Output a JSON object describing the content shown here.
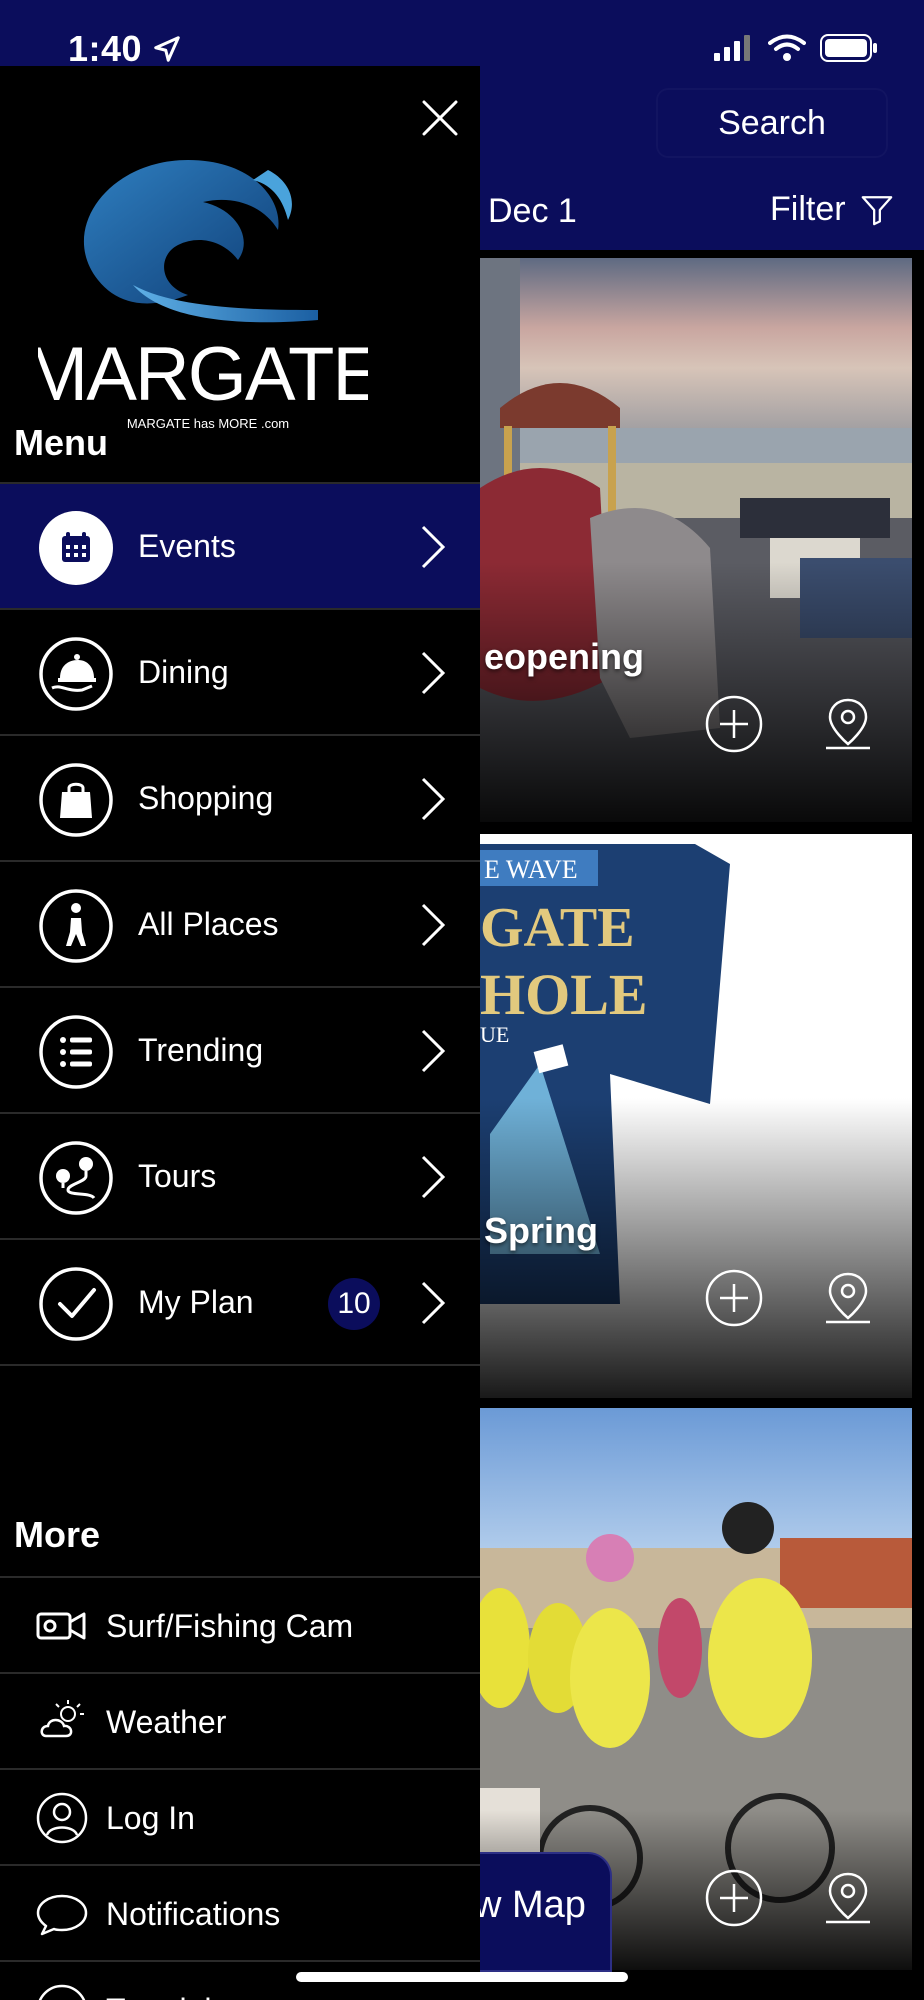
{
  "status_bar": {
    "time": "1:40"
  },
  "header": {
    "search_label": "Search",
    "date_range": "Dec 1",
    "filter_label": "Filter"
  },
  "cards": [
    {
      "title": "eopening"
    },
    {
      "title": "Spring"
    },
    {
      "title": ""
    }
  ],
  "view_map_label": "w Map",
  "drawer": {
    "logo_text": "MARGATE",
    "logo_subtext": "MARGATE has MORE .com",
    "menu_title": "Menu",
    "menu_items": [
      {
        "label": "Events",
        "icon": "calendar-icon",
        "active": true
      },
      {
        "label": "Dining",
        "icon": "cloche-icon"
      },
      {
        "label": "Shopping",
        "icon": "shopping-bag-icon"
      },
      {
        "label": "All Places",
        "icon": "walking-person-icon"
      },
      {
        "label": "Trending",
        "icon": "list-icon"
      },
      {
        "label": "Tours",
        "icon": "route-icon"
      },
      {
        "label": "My Plan",
        "icon": "checkmark-icon",
        "badge": "10"
      }
    ],
    "more_title": "More",
    "more_items": [
      {
        "label": "Surf/Fishing Cam",
        "icon": "video-camera-icon"
      },
      {
        "label": "Weather",
        "icon": "weather-icon"
      },
      {
        "label": "Log In",
        "icon": "user-icon"
      },
      {
        "label": "Notifications",
        "icon": "chat-bubble-icon"
      },
      {
        "label": "Tutorials",
        "icon": "help-icon"
      }
    ]
  },
  "colors": {
    "brand_navy": "#0b0d5c",
    "background": "#000000",
    "text": "#ffffff"
  }
}
